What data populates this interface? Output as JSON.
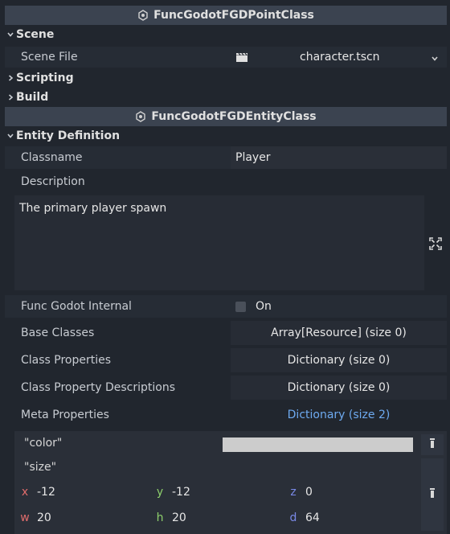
{
  "headers": {
    "point_class": "FuncGodotFGDPointClass",
    "entity_class": "FuncGodotFGDEntityClass"
  },
  "sections": {
    "scene": "Scene",
    "scripting": "Scripting",
    "build": "Build",
    "entity_definition": "Entity Definition"
  },
  "scene": {
    "scene_file_label": "Scene File",
    "scene_file_value": "character.tscn"
  },
  "entity": {
    "classname_label": "Classname",
    "classname_value": "Player",
    "description_label": "Description",
    "description_value": "The primary player spawn",
    "internal_label": "Func Godot Internal",
    "internal_toggle": "On",
    "base_classes_label": "Base Classes",
    "base_classes_value": "Array[Resource] (size 0)",
    "class_properties_label": "Class Properties",
    "class_properties_value": "Dictionary (size 0)",
    "class_property_desc_label": "Class Property Descriptions",
    "class_property_desc_value": "Dictionary (size 0)",
    "meta_properties_label": "Meta Properties",
    "meta_properties_value": "Dictionary (size 2)"
  },
  "meta": {
    "color_key": "\"color\"",
    "color_value": "#cccccc",
    "size_key": "\"size\"",
    "axes": [
      "x",
      "y",
      "z",
      "w",
      "h",
      "d"
    ],
    "values": [
      "-12",
      "-12",
      "0",
      "20",
      "20",
      "64"
    ]
  },
  "colors": {
    "accent_link": "#6eaaf0",
    "panel_bg": "#21262e",
    "header_bg": "#3b4350"
  }
}
